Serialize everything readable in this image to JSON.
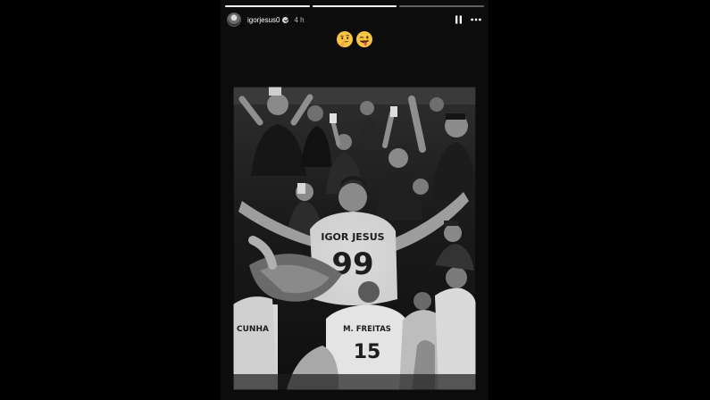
{
  "story": {
    "username": "igorjesus0",
    "time": "4 h",
    "progress": [
      1,
      1,
      0
    ],
    "icons": {
      "avatar": "profile-avatar",
      "verified": "verified-badge-icon",
      "pause": "pause-icon",
      "more": "more-options-icon"
    },
    "sticker_emojis": [
      "thinking-face-emoji",
      "winking-face-with-tongue-emoji"
    ],
    "photo": {
      "name_on_jersey": "IGOR JESUS",
      "number": "99",
      "other_names": [
        "M. FREITAS",
        "CUNHA"
      ],
      "other_number": "15",
      "color_mode": "black-and-white"
    }
  }
}
